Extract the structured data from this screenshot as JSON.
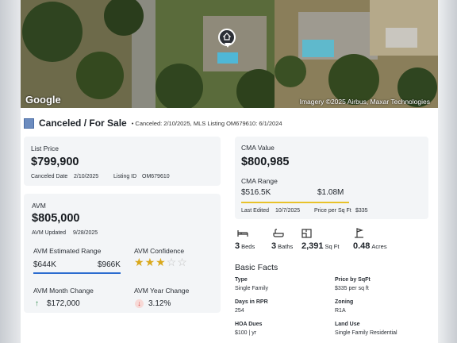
{
  "map": {
    "logo": "Google",
    "attribution": "Imagery ©2025 Airbus, Maxar Technologies"
  },
  "status": {
    "label": "Canceled / For Sale",
    "detail": "• Canceled: 2/10/2025, MLS Listing OM679610: 6/1/2024",
    "color": "#6c8cbf"
  },
  "list_price": {
    "label": "List Price",
    "value": "$799,900",
    "canceled_label": "Canceled Date",
    "canceled_date": "2/10/2025",
    "listing_label": "Listing ID",
    "listing_id": "OM679610"
  },
  "avm": {
    "label": "AVM",
    "value": "$805,000",
    "updated_label": "AVM Updated",
    "updated_date": "9/28/2025",
    "range_label": "AVM Estimated Range",
    "range_low": "$644K",
    "range_high": "$966K",
    "confidence_label": "AVM Confidence",
    "confidence_stars": 3,
    "confidence_max": 5,
    "month_change_label": "AVM Month Change",
    "month_change": "$172,000",
    "year_change_label": "AVM Year Change",
    "year_change": "3.12%"
  },
  "cma": {
    "label": "CMA Value",
    "value": "$800,985",
    "range_label": "CMA Range",
    "range_low": "$516.5K",
    "range_high": "$1.08M",
    "last_edited_label": "Last Edited",
    "last_edited": "10/7/2025",
    "price_sqft_label": "Price per Sq Ft",
    "price_sqft": "$335"
  },
  "features": {
    "beds": "3",
    "beds_unit": "Beds",
    "baths": "3",
    "baths_unit": "Baths",
    "sqft": "2,391",
    "sqft_unit": "Sq Ft",
    "acres": "0.48",
    "acres_unit": "Acres"
  },
  "basic_facts": {
    "title": "Basic Facts",
    "items": [
      {
        "key": "Type",
        "value": "Single Family"
      },
      {
        "key": "Price by SqFt",
        "value": "$335 per sq ft"
      },
      {
        "key": "Days in RPR",
        "value": "254"
      },
      {
        "key": "Zoning",
        "value": "R1A"
      },
      {
        "key": "HOA Dues",
        "value": "$100 | yr"
      },
      {
        "key": "Land Use",
        "value": "Single Family Residential"
      }
    ]
  }
}
